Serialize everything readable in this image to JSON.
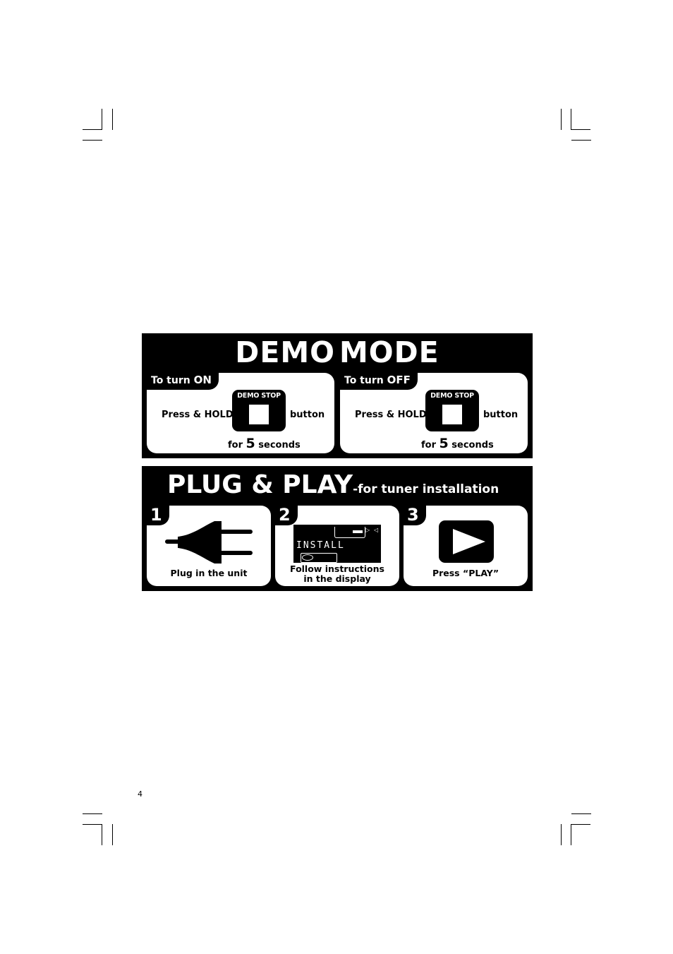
{
  "demo_mode": {
    "title_words": [
      "DEMO",
      "MODE"
    ],
    "turn_on": {
      "tab_prefix": "To turn ",
      "tab_state": "ON",
      "press_label": "Press & HOLD",
      "button_label": "DEMO STOP",
      "button_word": "button",
      "for_label": "for ",
      "duration": "5",
      "seconds_label": " seconds"
    },
    "turn_off": {
      "tab_prefix": "To turn ",
      "tab_state": "OFF",
      "press_label": "Press & HOLD",
      "button_label": "DEMO STOP",
      "button_word": "button",
      "for_label": "for ",
      "duration": "5",
      "seconds_label": " seconds"
    }
  },
  "plug_and_play": {
    "title": "PLUG & PLAY",
    "subtitle": "-for tuner installation",
    "steps": [
      {
        "number": "1",
        "icon": "power-plug-icon",
        "caption": "Plug in the unit"
      },
      {
        "number": "2",
        "icon": "lcd-display-icon",
        "caption_line1": "Follow instructions",
        "caption_line2": "in the display",
        "display_text": "INSTALL"
      },
      {
        "number": "3",
        "icon": "play-button-icon",
        "caption": "Press “PLAY”"
      }
    ]
  },
  "page_number": "4"
}
